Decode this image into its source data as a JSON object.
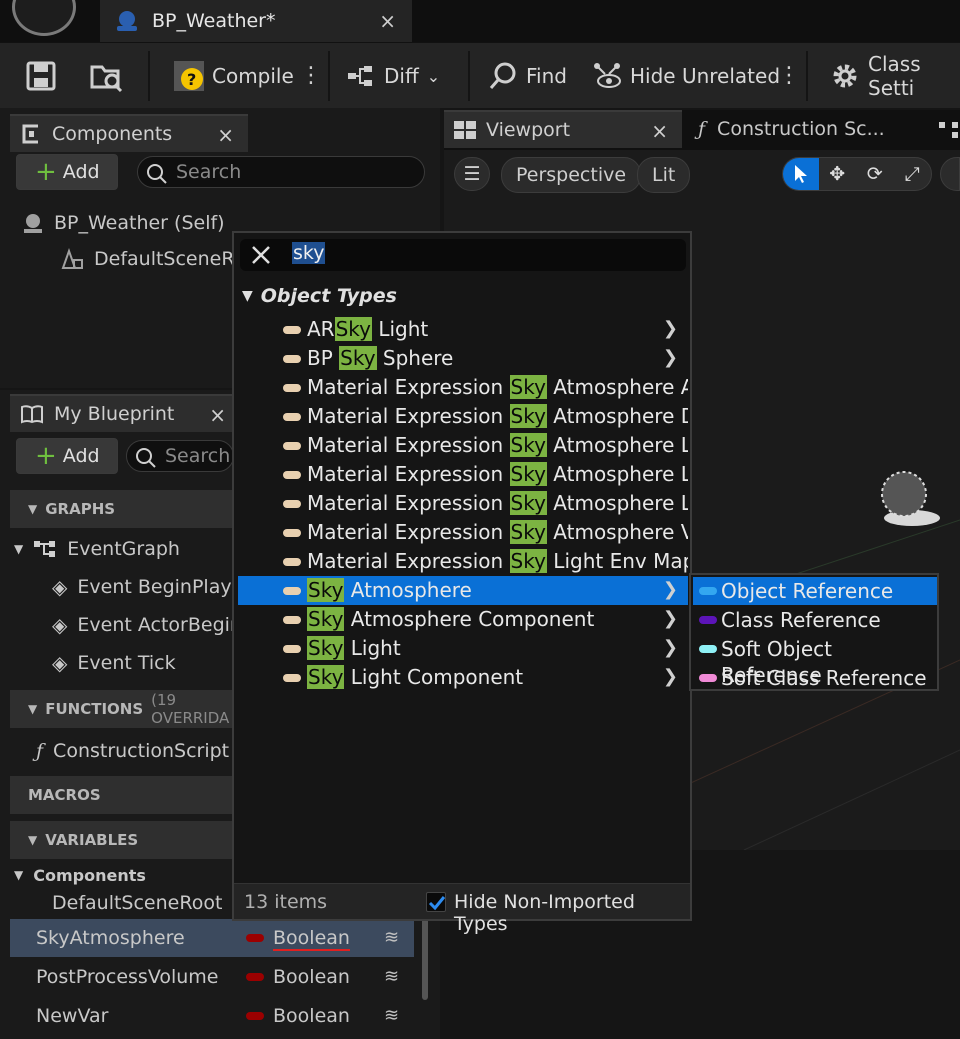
{
  "titlebar": {
    "doc_tab": "BP_Weather*",
    "close": "×"
  },
  "toolbar": {
    "compile": "Compile",
    "diff": "Diff",
    "find": "Find",
    "hide_unrelated": "Hide Unrelated",
    "class_settings": "Class Setti"
  },
  "components_panel": {
    "title": "Components",
    "close": "×",
    "add": "Add",
    "search_placeholder": "Search",
    "items": [
      "BP_Weather (Self)",
      "DefaultSceneRo"
    ]
  },
  "viewport": {
    "tabs": [
      "Viewport",
      "Construction Sc..."
    ],
    "close": "×",
    "perspective": "Perspective",
    "lit": "Lit"
  },
  "my_blueprint": {
    "title": "My Blueprint",
    "close": "×",
    "add": "Add",
    "search_placeholder": "Search",
    "graphs_label": "GRAPHS",
    "event_graph": "EventGraph",
    "events": [
      "Event BeginPlay",
      "Event ActorBegin",
      "Event Tick"
    ],
    "functions_label": "FUNCTIONS",
    "functions_note": "(19 OVERRIDA",
    "construction_script": "ConstructionScript",
    "macros_label": "MACROS",
    "variables_label": "VARIABLES",
    "components_group": "Components",
    "default_scene_root": "DefaultSceneRoot",
    "variables": [
      {
        "name": "SkyAtmosphere",
        "type": "Boolean"
      },
      {
        "name": "PostProcessVolume",
        "type": "Boolean"
      },
      {
        "name": "NewVar",
        "type": "Boolean"
      }
    ]
  },
  "type_picker": {
    "search_value": "sky",
    "category": "Object Types",
    "items": [
      {
        "pre": "AR",
        "hl": "Sky",
        "post": " Light",
        "arrow": true
      },
      {
        "pre": "BP ",
        "hl": "Sky",
        "post": " Sphere",
        "arrow": true
      },
      {
        "pre": "Material Expression ",
        "hl": "Sky",
        "post": " Atmosphere A",
        "arrow": false
      },
      {
        "pre": "Material Expression ",
        "hl": "Sky",
        "post": " Atmosphere D",
        "arrow": false
      },
      {
        "pre": "Material Expression ",
        "hl": "Sky",
        "post": " Atmosphere L",
        "arrow": false
      },
      {
        "pre": "Material Expression ",
        "hl": "Sky",
        "post": " Atmosphere L",
        "arrow": false
      },
      {
        "pre": "Material Expression ",
        "hl": "Sky",
        "post": " Atmosphere L",
        "arrow": false
      },
      {
        "pre": "Material Expression ",
        "hl": "Sky",
        "post": " Atmosphere V",
        "arrow": false
      },
      {
        "pre": "Material Expression ",
        "hl": "Sky",
        "post": " Light Env Map",
        "arrow": false
      },
      {
        "pre": "",
        "hl": "Sky",
        "post": " Atmosphere",
        "arrow": true,
        "selected": true
      },
      {
        "pre": "",
        "hl": "Sky",
        "post": " Atmosphere Component",
        "arrow": true
      },
      {
        "pre": "",
        "hl": "Sky",
        "post": " Light",
        "arrow": true
      },
      {
        "pre": "",
        "hl": "Sky",
        "post": " Light Component",
        "arrow": true
      }
    ],
    "count": "13 items",
    "hide_non_imported": "Hide Non-Imported Types",
    "hide_non_imported_checked": true
  },
  "reference_menu": {
    "items": [
      {
        "label": "Object Reference",
        "color": "#33a7f0",
        "selected": true
      },
      {
        "label": "Class Reference",
        "color": "#5c14b8"
      },
      {
        "label": "Soft Object Reference",
        "color": "#8ff0f5"
      },
      {
        "label": "Soft Class Reference",
        "color": "#f08ad6"
      }
    ]
  },
  "colors": {
    "accent": "#0a70d6",
    "highlight": "#7cb342",
    "boolean_pin": "#9b0000"
  }
}
